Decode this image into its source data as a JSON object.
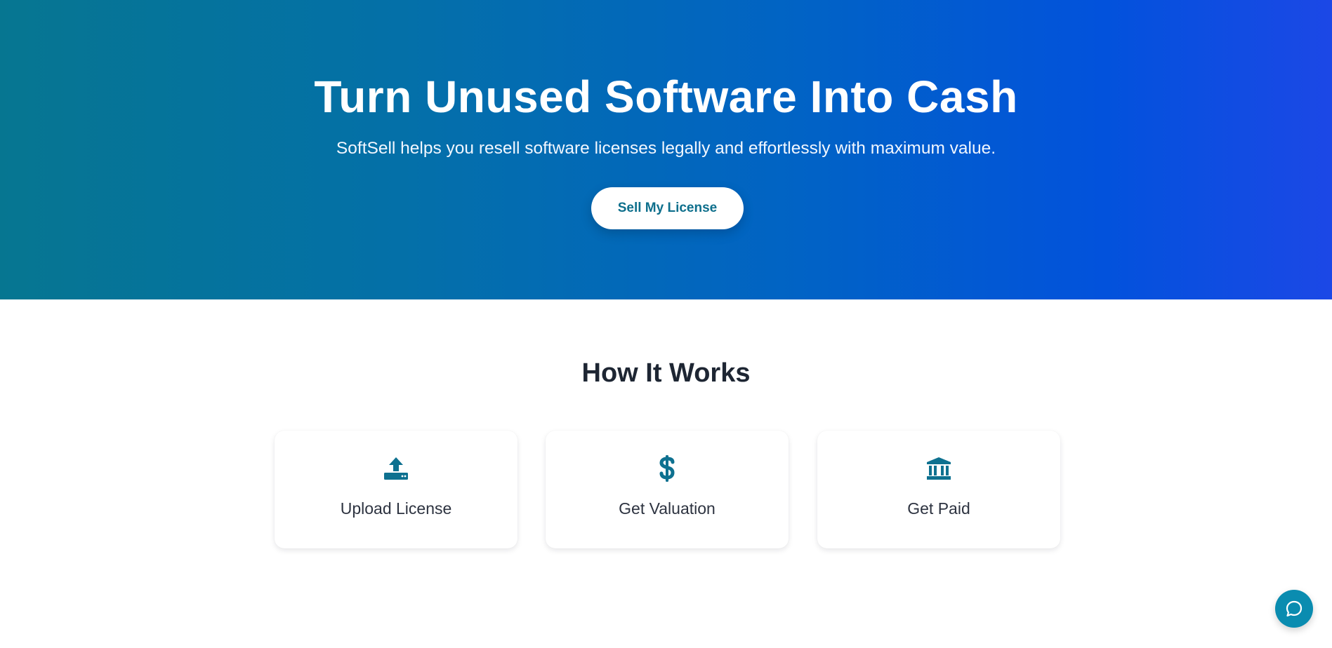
{
  "hero": {
    "title": "Turn Unused Software Into Cash",
    "subtitle": "SoftSell helps you resell software licenses legally and effortlessly with maximum value.",
    "cta_label": "Sell My License"
  },
  "how_it_works": {
    "title": "How It Works",
    "steps": [
      {
        "label": "Upload License",
        "icon": "upload-icon"
      },
      {
        "label": "Get Valuation",
        "icon": "dollar-icon"
      },
      {
        "label": "Get Paid",
        "icon": "bank-icon"
      }
    ]
  },
  "chat": {
    "icon": "chat-bubble-icon"
  },
  "colors": {
    "hero_gradient_start": "#067691",
    "hero_gradient_end": "#1c48e6",
    "accent": "#0e6f8c",
    "heading": "#1e2633",
    "chat_button": "#0a8cb0"
  }
}
